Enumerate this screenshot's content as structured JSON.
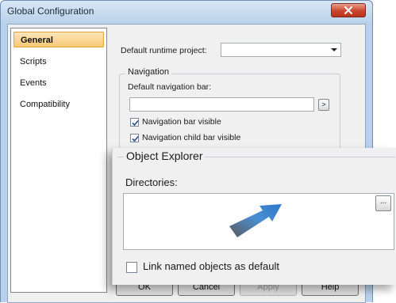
{
  "window": {
    "title": "Global Configuration",
    "close_icon": "close-icon"
  },
  "nav": {
    "items": [
      {
        "label": "General",
        "selected": true
      },
      {
        "label": "Scripts",
        "selected": false
      },
      {
        "label": "Events",
        "selected": false
      },
      {
        "label": "Compatibility",
        "selected": false
      }
    ]
  },
  "general": {
    "runtime_project_label": "Default runtime project:",
    "runtime_project_value": "",
    "navigation": {
      "group_title": "Navigation",
      "default_bar_label": "Default navigation bar:",
      "default_bar_value": "",
      "browse_label": ">",
      "bar_visible_label": "Navigation bar visible",
      "bar_visible_checked": true,
      "child_bar_visible_label": "Navigation child bar visible",
      "child_bar_visible_checked": true
    }
  },
  "object_explorer": {
    "group_title": "Object Explorer",
    "directories_label": "Directories:",
    "directories_value": "",
    "browse_label": "...",
    "link_named_label": "Link named objects as default",
    "link_named_checked": false
  },
  "buttons": {
    "ok": "OK",
    "cancel": "Cancel",
    "apply": "Apply",
    "help": "Help"
  },
  "colors": {
    "accent_arrow": "#4a8fd4",
    "selection": "#f9c874"
  }
}
